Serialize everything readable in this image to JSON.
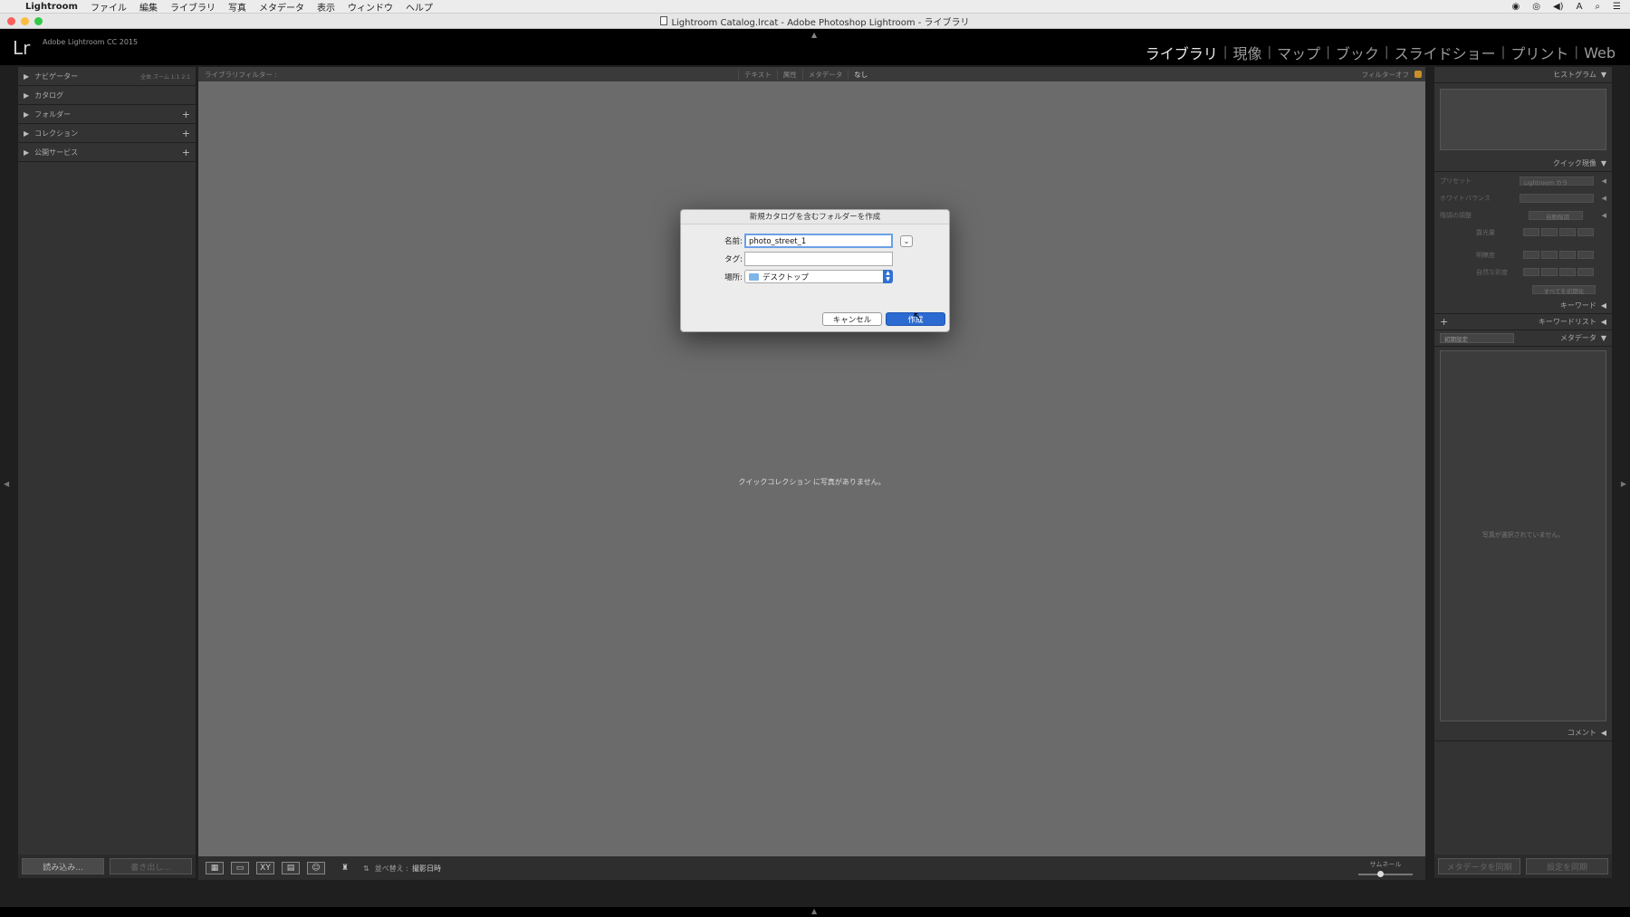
{
  "menubar": {
    "items": [
      "Lightroom",
      "ファイル",
      "編集",
      "ライブラリ",
      "写真",
      "メタデータ",
      "表示",
      "ウィンドウ",
      "ヘルプ"
    ]
  },
  "window": {
    "title": "Lightroom Catalog.lrcat - Adobe Photoshop Lightroom - ライブラリ"
  },
  "header": {
    "logo": "Lr",
    "version": "Adobe Lightroom CC 2015",
    "modules": [
      "ライブラリ",
      "現像",
      "マップ",
      "ブック",
      "スライドショー",
      "プリント",
      "Web"
    ],
    "active_module": "ライブラリ"
  },
  "left_panel": {
    "rows": [
      {
        "label": "ナビゲーター",
        "plus": false
      },
      {
        "label": "カタログ",
        "plus": false
      },
      {
        "label": "フォルダー",
        "plus": true
      },
      {
        "label": "コレクション",
        "plus": true
      },
      {
        "label": "公開サービス",
        "plus": true
      }
    ],
    "navigator_options": "全体   ズーム   1:1   2:1",
    "import_label": "読み込み...",
    "export_label": "書き出し..."
  },
  "filter_bar": {
    "label": "ライブラリフィルター :",
    "options": [
      "テキスト",
      "属性",
      "メタデータ",
      "なし"
    ],
    "selected": "なし",
    "filter_off": "フィルターオフ"
  },
  "center": {
    "empty_message": "クイックコレクション に写真がありません。"
  },
  "toolbar": {
    "sort_label": "並べ替え :",
    "sort_value": "撮影日時",
    "thumbnail_label": "サムネール",
    "thumbnail_level": 0.4
  },
  "right_panel": {
    "histogram": "ヒストグラム",
    "quick_develop": "クイック現像",
    "preset_label": "プリセット",
    "preset_value": "Lightroom カラ",
    "wb_label": "ホワイトバランス",
    "tone_label": "階調の調整",
    "auto_tone": "自動階調",
    "exposure_label": "露光量",
    "clarity_label": "明瞭度",
    "vibrance_label": "自然な彩度",
    "reset_all": "すべてを初期化",
    "keywording": "キーワード",
    "keyword_list": "キーワードリスト",
    "metadata": "メタデータ",
    "metadata_preset": "初期設定",
    "no_photo_msg": "写真が選択されていません。",
    "comments": "コメント",
    "sync_metadata": "メタデータを同期",
    "sync_settings": "設定を同期"
  },
  "dialog": {
    "title": "新規カタログを含むフォルダーを作成",
    "name_label": "名前:",
    "name_value": "photo_street_1",
    "tags_label": "タグ:",
    "tags_value": "",
    "location_label": "場所:",
    "location_value": "デスクトップ",
    "cancel_label": "キャンセル",
    "create_label": "作成"
  },
  "colors": {
    "accent_blue": "#2b6bd1",
    "active_module": "#e8e8e8",
    "center_bg": "#6b6b6b"
  }
}
